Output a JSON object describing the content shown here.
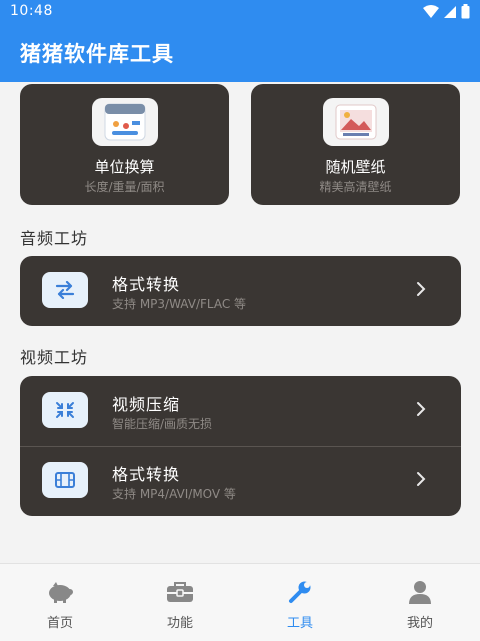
{
  "status_bar": {
    "time": "10:48"
  },
  "app_bar": {
    "title": "猪猪软件库工具"
  },
  "tiles": [
    {
      "title": "单位换算",
      "subtitle": "长度/重量/面积",
      "icon": "calculator-icon"
    },
    {
      "title": "随机壁纸",
      "subtitle": "精美高清壁纸",
      "icon": "wallpaper-icon"
    }
  ],
  "audio_section": {
    "title": "音频工坊",
    "items": [
      {
        "title": "格式转换",
        "subtitle": "支持 MP3/WAV/FLAC 等",
        "icon": "swap-arrows-icon"
      }
    ]
  },
  "video_section": {
    "title": "视频工坊",
    "items": [
      {
        "title": "视频压缩",
        "subtitle": "智能压缩/画质无损",
        "icon": "compress-icon"
      },
      {
        "title": "格式转换",
        "subtitle": "支持 MP4/AVI/MOV 等",
        "icon": "film-icon"
      }
    ]
  },
  "tab_bar": {
    "active": "工具",
    "tabs": [
      {
        "label": "首页",
        "icon": "piggy-bank-icon"
      },
      {
        "label": "功能",
        "icon": "toolbox-icon"
      },
      {
        "label": "工具",
        "icon": "wrench-icon"
      },
      {
        "label": "我的",
        "icon": "person-icon"
      }
    ]
  },
  "colors": {
    "primary": "#2f8cf0",
    "card": "#3a3633",
    "background": "#f3f3f3"
  }
}
